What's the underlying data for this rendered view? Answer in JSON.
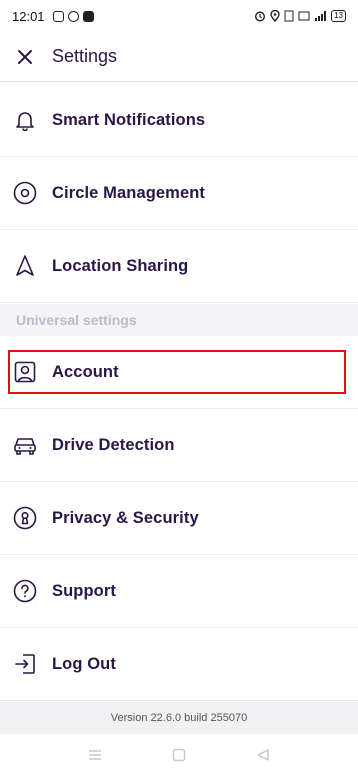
{
  "status_bar": {
    "time": "12:01",
    "battery": "13"
  },
  "header": {
    "title": "Settings",
    "close_icon": "close-icon"
  },
  "menu": {
    "items": [
      {
        "label": "Smart Notifications",
        "icon": "bell-icon"
      },
      {
        "label": "Circle Management",
        "icon": "circle-target-icon"
      },
      {
        "label": "Location Sharing",
        "icon": "navigation-arrow-icon"
      }
    ]
  },
  "universal": {
    "section_label": "Universal settings",
    "items": [
      {
        "label": "Account",
        "icon": "user-portrait-icon"
      },
      {
        "label": "Drive Detection",
        "icon": "car-icon"
      },
      {
        "label": "Privacy & Security",
        "icon": "keyhole-icon"
      },
      {
        "label": "Support",
        "icon": "question-circle-icon"
      },
      {
        "label": "Log Out",
        "icon": "logout-icon"
      }
    ]
  },
  "footer": {
    "version": "Version 22.6.0 build 255070"
  },
  "colors": {
    "text": "#2b1747",
    "section_text": "#c0b8cc",
    "highlight": "#e01010"
  }
}
